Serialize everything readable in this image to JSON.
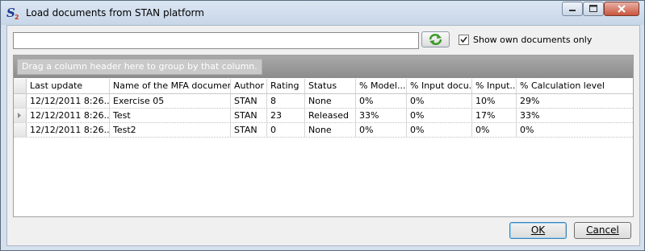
{
  "window": {
    "title": "Load documents from STAN platform"
  },
  "search": {
    "value": "",
    "placeholder": ""
  },
  "checkbox": {
    "label": "Show own documents only",
    "checked": true
  },
  "grid": {
    "group_hint": "Drag a column header here to group by that column.",
    "columns": [
      "Last update",
      "Name of the MFA document",
      "Author",
      "Rating",
      "Status",
      "% Model...",
      "% Input docu...",
      "% Input...",
      "% Calculation level"
    ],
    "rows": [
      [
        "12/12/2011  8:26...",
        "Exercise 05",
        "STAN",
        "8",
        "None",
        "0%",
        "0%",
        "10%",
        "29%"
      ],
      [
        "12/12/2011  8:26...",
        "Test",
        "STAN",
        "23",
        "Released",
        "33%",
        "0%",
        "17%",
        "33%"
      ],
      [
        "12/12/2011  8:26...",
        "Test2",
        "STAN",
        "0",
        "None",
        "0%",
        "0%",
        "0%",
        "0%"
      ]
    ],
    "current_row": 1
  },
  "buttons": {
    "ok": "OK",
    "cancel": "Cancel"
  },
  "icons": {
    "app": "stan-logo-icon",
    "refresh": "refresh-icon",
    "minimize": "minimize-icon",
    "maximize": "maximize-icon",
    "close": "close-icon",
    "row_indicator": "row-pointer-icon"
  }
}
